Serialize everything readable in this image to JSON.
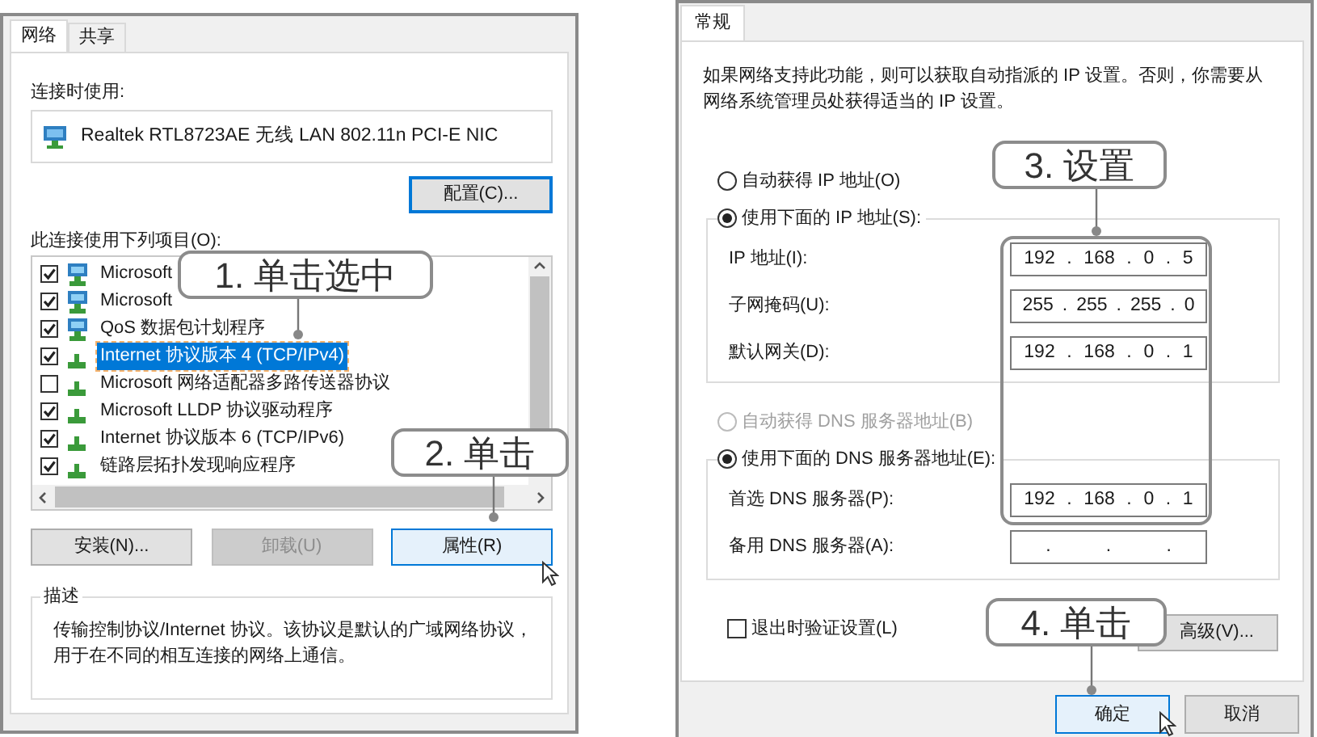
{
  "left_dialog": {
    "tabs": [
      {
        "label": "网络",
        "selected": true
      },
      {
        "label": "共享",
        "selected": false
      }
    ],
    "connect_using_label": "连接时使用:",
    "adapter_name": "Realtek RTL8723AE 无线 LAN 802.11n PCI-E NIC",
    "configure_button": "配置(C)...",
    "items_label": "此连接使用下列项目(O):",
    "items": [
      {
        "label": "Microsoft",
        "kind": "adapter",
        "checked": true,
        "selected": false
      },
      {
        "label": "Microsoft",
        "kind": "adapter",
        "checked": true,
        "selected": false
      },
      {
        "label": "QoS 数据包计划程序",
        "kind": "adapter",
        "checked": true,
        "selected": false
      },
      {
        "label": "Internet 协议版本 4 (TCP/IPv4)",
        "kind": "protocol",
        "checked": true,
        "selected": true
      },
      {
        "label": "Microsoft 网络适配器多路传送器协议",
        "kind": "protocol",
        "checked": false,
        "selected": false
      },
      {
        "label": "Microsoft LLDP 协议驱动程序",
        "kind": "protocol",
        "checked": true,
        "selected": false
      },
      {
        "label": "Internet 协议版本 6 (TCP/IPv6)",
        "kind": "protocol",
        "checked": true,
        "selected": false
      },
      {
        "label": "链路层拓扑发现响应程序",
        "kind": "protocol",
        "checked": true,
        "selected": false
      }
    ],
    "buttons": [
      {
        "label": "安装(N)...",
        "disabled": false,
        "highlighted": false
      },
      {
        "label": "卸载(U)",
        "disabled": true,
        "highlighted": false
      },
      {
        "label": "属性(R)",
        "disabled": false,
        "highlighted": true
      }
    ],
    "description": {
      "title": "描述",
      "text": "传输控制协议/Internet 协议。该协议是默认的广域网络协议，用于在不同的相互连接的网络上通信。"
    }
  },
  "right_dialog": {
    "tabs": [
      {
        "label": "常规",
        "selected": true
      }
    ],
    "intro": "如果网络支持此功能，则可以获取自动指派的 IP 设置。否则，你需要从网络系统管理员处获得适当的 IP 设置。",
    "ip_options": [
      {
        "label": "自动获得 IP 地址(O)",
        "selected": false,
        "disabled": false
      },
      {
        "label": "使用下面的 IP 地址(S):",
        "selected": true,
        "disabled": false
      }
    ],
    "ip_fields": [
      {
        "label": "IP 地址(I):",
        "parts": [
          "192",
          ".",
          "168",
          ".",
          "0",
          ".",
          "5"
        ]
      },
      {
        "label": "子网掩码(U):",
        "parts": [
          "255",
          ".",
          "255",
          ".",
          "255",
          ".",
          "0"
        ]
      },
      {
        "label": "默认网关(D):",
        "parts": [
          "192",
          ".",
          "168",
          ".",
          "0",
          ".",
          "1"
        ]
      }
    ],
    "dns_options": [
      {
        "label": "自动获得 DNS 服务器地址(B)",
        "selected": false,
        "disabled": true
      },
      {
        "label": "使用下面的 DNS 服务器地址(E):",
        "selected": true,
        "disabled": false
      }
    ],
    "dns_fields": [
      {
        "label": "首选 DNS 服务器(P):",
        "parts": [
          "192",
          ".",
          "168",
          ".",
          "0",
          ".",
          "1"
        ]
      },
      {
        "label": "备用 DNS 服务器(A):",
        "parts": [
          ".",
          ".",
          "."
        ]
      }
    ],
    "validate_checkbox": {
      "label": "退出时验证设置(L)",
      "checked": false
    },
    "advanced_button": "高级(V)...",
    "footer_buttons": [
      {
        "label": "确定",
        "default": true
      },
      {
        "label": "取消",
        "default": false
      }
    ]
  },
  "callouts": [
    {
      "text": "1. 单击选中"
    },
    {
      "text": "2. 单击"
    },
    {
      "text": "3. 设置"
    },
    {
      "text": "4. 单击"
    }
  ]
}
